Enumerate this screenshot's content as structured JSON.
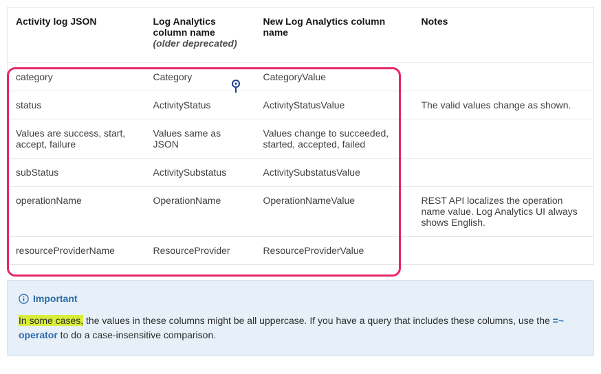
{
  "table": {
    "headers": {
      "c1": "Activity log JSON",
      "c2": "Log Analytics column name",
      "c2_sub": "(older deprecated)",
      "c3": "New Log Analytics column name",
      "c4": "Notes"
    },
    "rows": [
      {
        "c1": "category",
        "c2": "Category",
        "c3": "CategoryValue",
        "c4": ""
      },
      {
        "c1": "status",
        "c2": "ActivityStatus",
        "c3": "ActivityStatusValue",
        "c4": "The valid values change as shown."
      },
      {
        "c1": "Values are success, start, accept, failure",
        "c2": "Values same as JSON",
        "c3": "Values change to succeeded, started, accepted, failed",
        "c4": ""
      },
      {
        "c1": "subStatus",
        "c2": "ActivitySubstatus",
        "c3": "ActivitySubstatusValue",
        "c4": ""
      },
      {
        "c1": "operationName",
        "c2": "OperationName",
        "c3": "OperationNameValue",
        "c4": "REST API localizes the operation name value. Log Analytics UI always shows English."
      },
      {
        "c1": "resourceProviderName",
        "c2": "ResourceProvider",
        "c3": "ResourceProviderValue",
        "c4": ""
      }
    ]
  },
  "alert": {
    "title": "Important",
    "highlight": "In some cases,",
    "body_before_link": " the values in these columns might be all uppercase. If you have a query that includes these columns, use the ",
    "link": "=~ operator",
    "body_after_link": " to do a case-insensitive comparison."
  }
}
